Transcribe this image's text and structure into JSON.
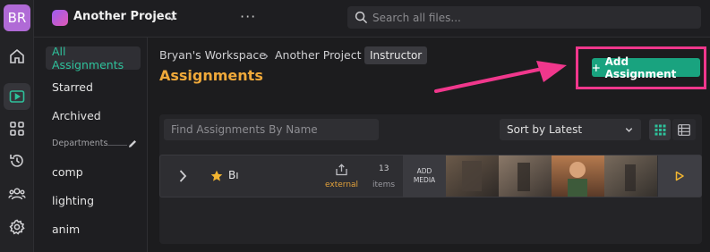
{
  "user": {
    "initials": "BR"
  },
  "rail": {
    "icons": [
      "home-icon",
      "media-icon",
      "grid-icon",
      "history-icon",
      "users-icon",
      "settings-icon"
    ]
  },
  "topbar": {
    "project_name": "Another Project",
    "search_placeholder": "Search all files..."
  },
  "sidenav": {
    "items": [
      {
        "label": "All Assignments"
      },
      {
        "label": "Starred"
      },
      {
        "label": "Archived"
      }
    ],
    "departments_label": "Departments",
    "departments": [
      {
        "label": "comp"
      },
      {
        "label": "lighting"
      },
      {
        "label": "anim"
      }
    ]
  },
  "main": {
    "breadcrumb": {
      "workspace": "Bryan's Workspace",
      "project": "Another Project",
      "role_badge": "Instructor"
    },
    "title": "Assignments",
    "add_button_label": "Add Assignment",
    "find_placeholder": "Find Assignments By Name",
    "sort_label": "Sort by Latest",
    "rows": [
      {
        "name": "Bı",
        "starred": true,
        "source_label": "external",
        "count": "13",
        "count_label": "items",
        "add_media_label": "ADD MEDIA"
      }
    ]
  },
  "colors": {
    "accent_green": "#19a37f",
    "active_nav": "#2ec19b",
    "title_orange": "#f0a93a",
    "highlight_pink": "#f0378c",
    "avatar": "#b06ad6"
  }
}
